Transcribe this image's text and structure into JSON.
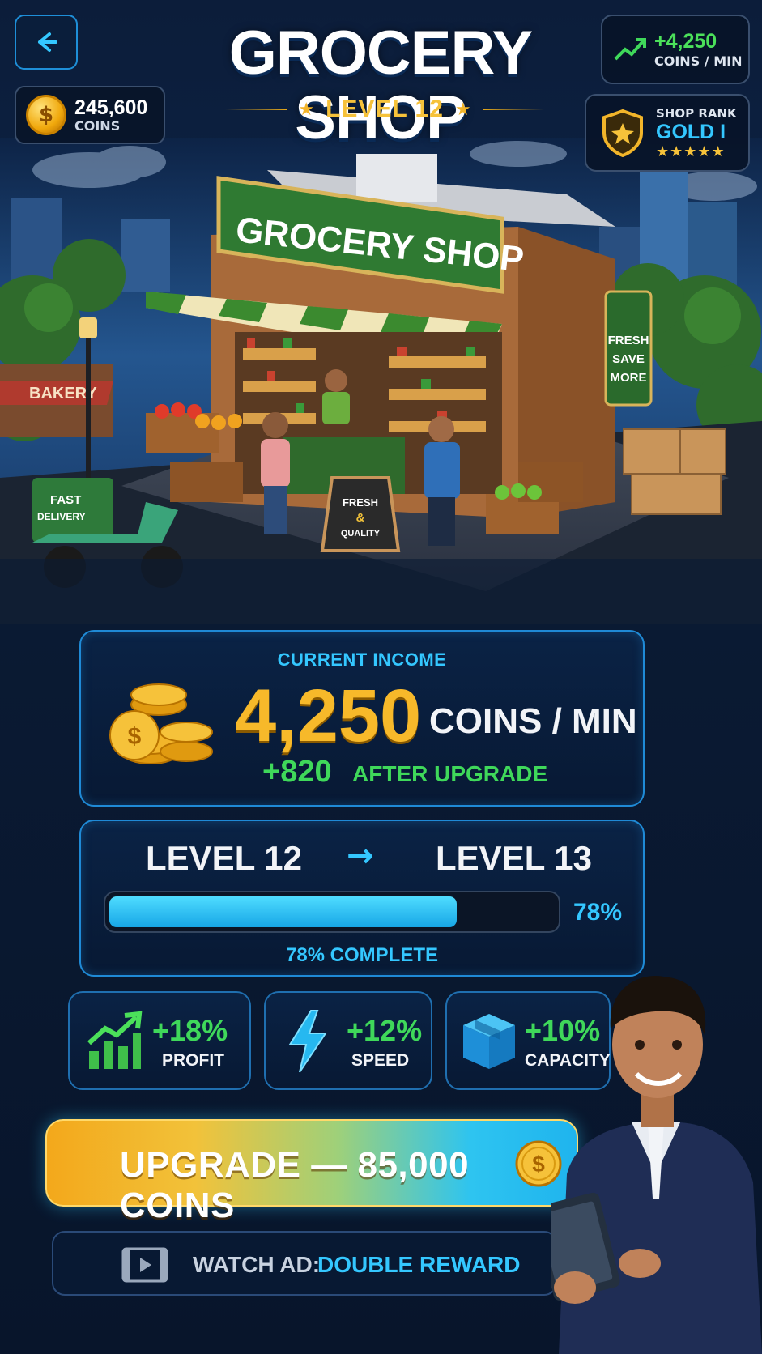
{
  "header": {
    "title": "GROCERY SHOP",
    "level": "LEVEL 12",
    "coins": {
      "value": "245,600",
      "label": "COINS"
    },
    "income": {
      "value": "+4,250",
      "label": "COINS / MIN"
    },
    "rank": {
      "label": "SHOP RANK",
      "tier": "GOLD I",
      "stars": "★★★★★"
    }
  },
  "scene": {
    "shop_sign": "GROCERY SHOP",
    "side_sign": [
      "FRESH",
      "SAVE",
      "MORE"
    ],
    "bakery_sign": "BAKERY",
    "delivery_box": [
      "FAST",
      "DELIVERY"
    ],
    "a_frame": [
      "FRESH",
      "&",
      "QUALITY"
    ]
  },
  "income_panel": {
    "label": "CURRENT INCOME",
    "value": "4,250",
    "unit": "COINS / MIN",
    "after_value": "+820",
    "after_label": "AFTER UPGRADE"
  },
  "level_panel": {
    "from": "LEVEL 12",
    "to": "LEVEL 13",
    "progress": 0.78,
    "progress_pct": "78%",
    "progress_text": "78% COMPLETE"
  },
  "stats": [
    {
      "value": "+18%",
      "label": "PROFIT",
      "icon": "growth-chart-icon"
    },
    {
      "value": "+12%",
      "label": "SPEED",
      "icon": "lightning-icon"
    },
    {
      "value": "+10%",
      "label": "CAPACITY",
      "icon": "box-icon"
    }
  ],
  "upgrade_button": {
    "label": "UPGRADE — 85,000 COINS"
  },
  "ad_button": {
    "label": "WATCH AD:",
    "reward": "DOUBLE REWARD"
  },
  "colors": {
    "accent_blue": "#34c7ff",
    "gold": "#f7b92a",
    "green": "#3fd85a",
    "shop_green": "#2f7a32"
  }
}
